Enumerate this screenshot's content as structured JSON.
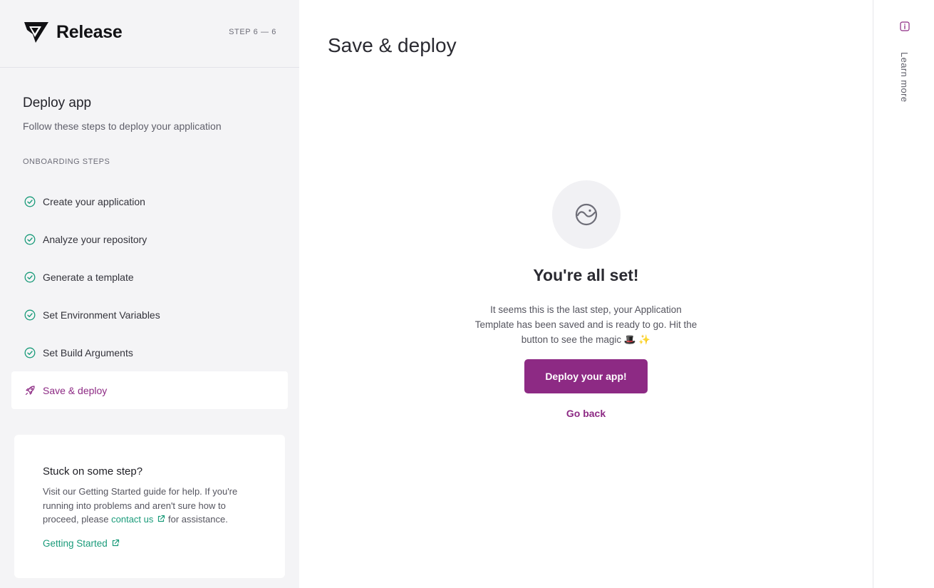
{
  "brand": {
    "name": "Release",
    "accent": "#8d2a84",
    "success": "#1a9b7a"
  },
  "sidebar": {
    "step_counter": "STEP 6 — 6",
    "title": "Deploy app",
    "subtitle": "Follow these steps to deploy your application",
    "section_label": "ONBOARDING STEPS",
    "steps": [
      {
        "label": "Create your application",
        "status": "done",
        "icon": "check-circle-icon"
      },
      {
        "label": "Analyze your repository",
        "status": "done",
        "icon": "check-circle-icon"
      },
      {
        "label": "Generate a template",
        "status": "done",
        "icon": "check-circle-icon"
      },
      {
        "label": "Set Environment Variables",
        "status": "done",
        "icon": "check-circle-icon"
      },
      {
        "label": "Set Build Arguments",
        "status": "done",
        "icon": "check-circle-icon"
      },
      {
        "label": "Save & deploy",
        "status": "active",
        "icon": "rocket-icon"
      }
    ],
    "help": {
      "title": "Stuck on some step?",
      "body_before": "Visit our Getting Started guide for help. If you're running into problems and aren't sure how to proceed, please ",
      "contact_link": "contact us",
      "body_after": " for assistance.",
      "guide_link": "Getting Started"
    }
  },
  "main": {
    "title": "Save & deploy",
    "done_title": "You're all set!",
    "done_text": "It seems this is the last step, your Application Template has been saved and is ready to go. Hit the button to see the magic 🎩 ✨",
    "deploy_button": "Deploy your app!",
    "back_link": "Go back"
  },
  "rail": {
    "learn_more": "Learn more",
    "icon": "info-icon"
  }
}
